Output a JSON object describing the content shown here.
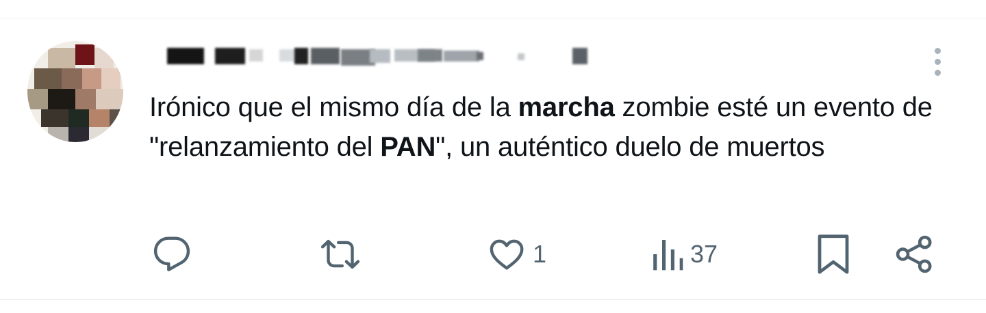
{
  "tweet": {
    "text_parts": [
      {
        "t": "Irónico que el mismo día de la ",
        "bold": false
      },
      {
        "t": "marcha",
        "bold": true
      },
      {
        "t": " zombie esté un evento de \"relanzamiento del ",
        "bold": false
      },
      {
        "t": "PAN",
        "bold": true
      },
      {
        "t": "\", un auténtico duelo de muertos",
        "bold": false
      }
    ]
  },
  "actions": {
    "reply_icon": "reply-icon",
    "retweet_icon": "retweet-icon",
    "like_icon": "heart-icon",
    "like_count": "1",
    "views_icon": "views-icon",
    "views_count": "37",
    "bookmark_icon": "bookmark-icon",
    "share_icon": "share-icon"
  },
  "colors": {
    "text": "#0f1419",
    "icon": "#536471",
    "divider": "#eff3f4"
  }
}
